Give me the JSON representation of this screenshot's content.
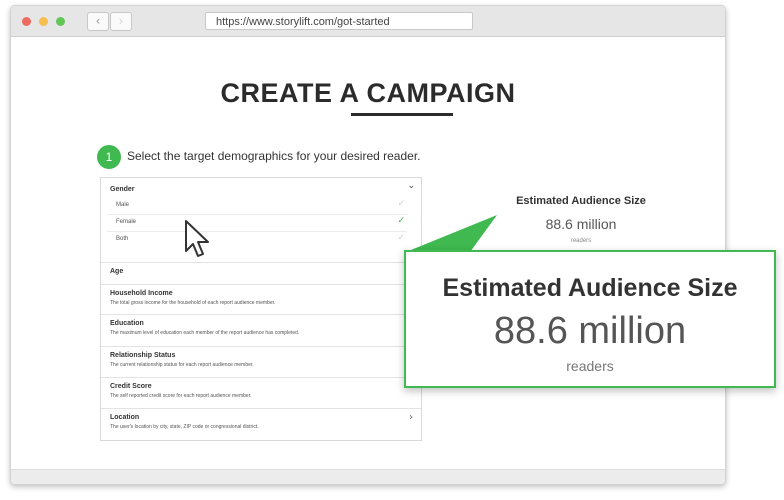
{
  "browser": {
    "url": "https://www.storylift.com/got-started",
    "back_icon": "‹",
    "forward_icon": "›"
  },
  "page": {
    "title": "CREATE A CAMPAIGN",
    "step_number": "1",
    "step_text": "Select the target demographics for your desired reader."
  },
  "form": {
    "gender": {
      "label": "Gender",
      "chevron": "⌄",
      "options": [
        {
          "label": "Male",
          "check": "✓",
          "selected": false
        },
        {
          "label": "Female",
          "check": "✓",
          "selected": true
        },
        {
          "label": "Both",
          "check": "✓",
          "selected": false
        }
      ]
    },
    "fields": [
      {
        "label": "Age",
        "description": ""
      },
      {
        "label": "Household Income",
        "description": "The total gross income for the household of each report audience member."
      },
      {
        "label": "Education",
        "description": "The maximum level of education each member of the report audience has completed."
      },
      {
        "label": "Relationship Status",
        "description": "The current relationship status for each report audience member."
      },
      {
        "label": "Credit Score",
        "description": "The self reported credit score for each report audience member."
      },
      {
        "label": "Location",
        "description": "The user's location by city, state, ZIP code or congressional district.",
        "chevron": "›"
      }
    ]
  },
  "audience": {
    "title": "Estimated Audience Size",
    "value": "88.6 million",
    "unit": "readers"
  },
  "colors": {
    "accent_green": "#3fb950"
  }
}
